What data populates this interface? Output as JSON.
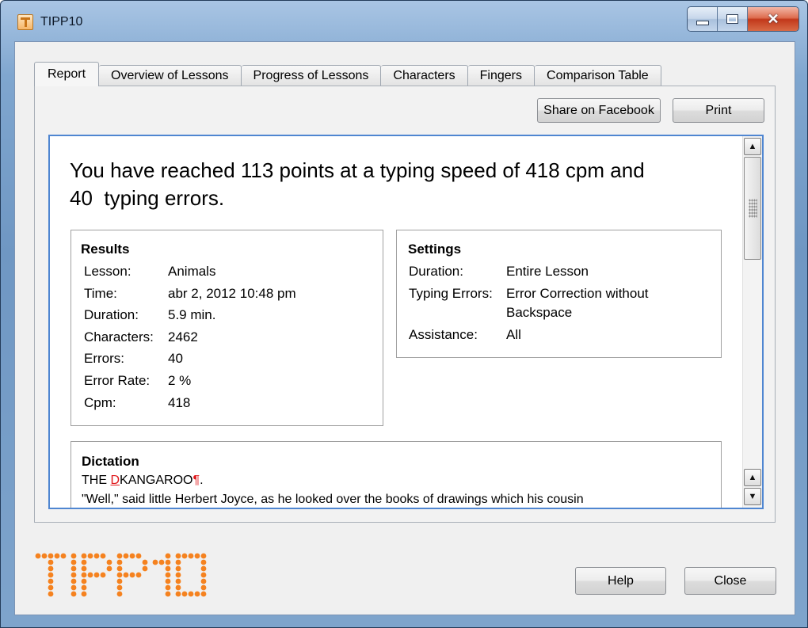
{
  "window": {
    "title": "TIPP10",
    "icon": "tipp10-app-icon"
  },
  "controls": {
    "minimize_icon": "minimize-icon",
    "maximize_icon": "maximize-icon",
    "close_glyph": "✕"
  },
  "tabs": [
    {
      "label": "Report",
      "active": true
    },
    {
      "label": "Overview of Lessons",
      "active": false
    },
    {
      "label": "Progress of Lessons",
      "active": false
    },
    {
      "label": "Characters",
      "active": false
    },
    {
      "label": "Fingers",
      "active": false
    },
    {
      "label": "Comparison Table",
      "active": false
    }
  ],
  "toolbar": {
    "share_label": "Share on Facebook",
    "print_label": "Print"
  },
  "report": {
    "headline_line1": "You have reached 113 points at a typing speed of 418 cpm and",
    "headline_line2": "40  typing errors.",
    "results": {
      "title": "Results",
      "rows": [
        {
          "key": "Lesson:",
          "value": "Animals"
        },
        {
          "key": "Time:",
          "value": "abr 2, 2012 10:48 pm"
        },
        {
          "key": "Duration:",
          "value": "5.9 min."
        },
        {
          "key": "Characters:",
          "value": "2462"
        },
        {
          "key": "Errors:",
          "value": "40"
        },
        {
          "key": "Error Rate:",
          "value": "2 %"
        },
        {
          "key": "Cpm:",
          "value": "418"
        }
      ]
    },
    "settings": {
      "title": "Settings",
      "rows": [
        {
          "key": "Duration:",
          "value": "Entire Lesson"
        },
        {
          "key": "Typing Errors:",
          "value": "Error Correction without",
          "value2": "Backspace"
        },
        {
          "key": "Assistance:",
          "value": "All"
        }
      ]
    },
    "dictation": {
      "title": "Dictation",
      "line1_pre": "THE ",
      "line1_err": "D",
      "line1_mid": "KANGAROO",
      "line1_mark": "¶",
      "line1_post": ".",
      "line2": "\"Well,\" said little Herbert Joyce, as he looked over the books of drawings which his cousin"
    }
  },
  "footer": {
    "logo_text": "TIPP10",
    "help_label": "Help",
    "close_label": "Close"
  },
  "colors": {
    "logo_orange": "#f5821f",
    "error_red": "#e0171a",
    "report_border": "#4f86d1"
  }
}
